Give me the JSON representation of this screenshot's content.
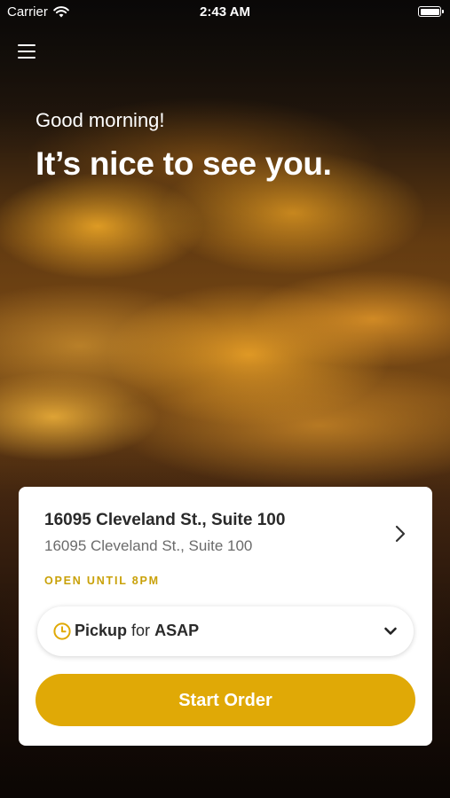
{
  "status_bar": {
    "carrier": "Carrier",
    "time": "2:43 AM"
  },
  "hero": {
    "greeting": "Good morning!",
    "headline": "It’s nice to see you."
  },
  "location_card": {
    "name": "16095 Cleveland St., Suite 100",
    "address": "16095 Cleveland St., Suite 100",
    "hours": "OPEN UNTIL 8PM",
    "order_type": "Pickup",
    "connector": "for",
    "order_time": "ASAP",
    "start_button": "Start Order"
  },
  "colors": {
    "accent": "#e0a906",
    "hours_text": "#c9a108"
  },
  "icons": [
    "wifi-icon",
    "battery-icon",
    "menu-icon",
    "chevron-right-icon",
    "clock-icon",
    "chevron-down-icon"
  ]
}
